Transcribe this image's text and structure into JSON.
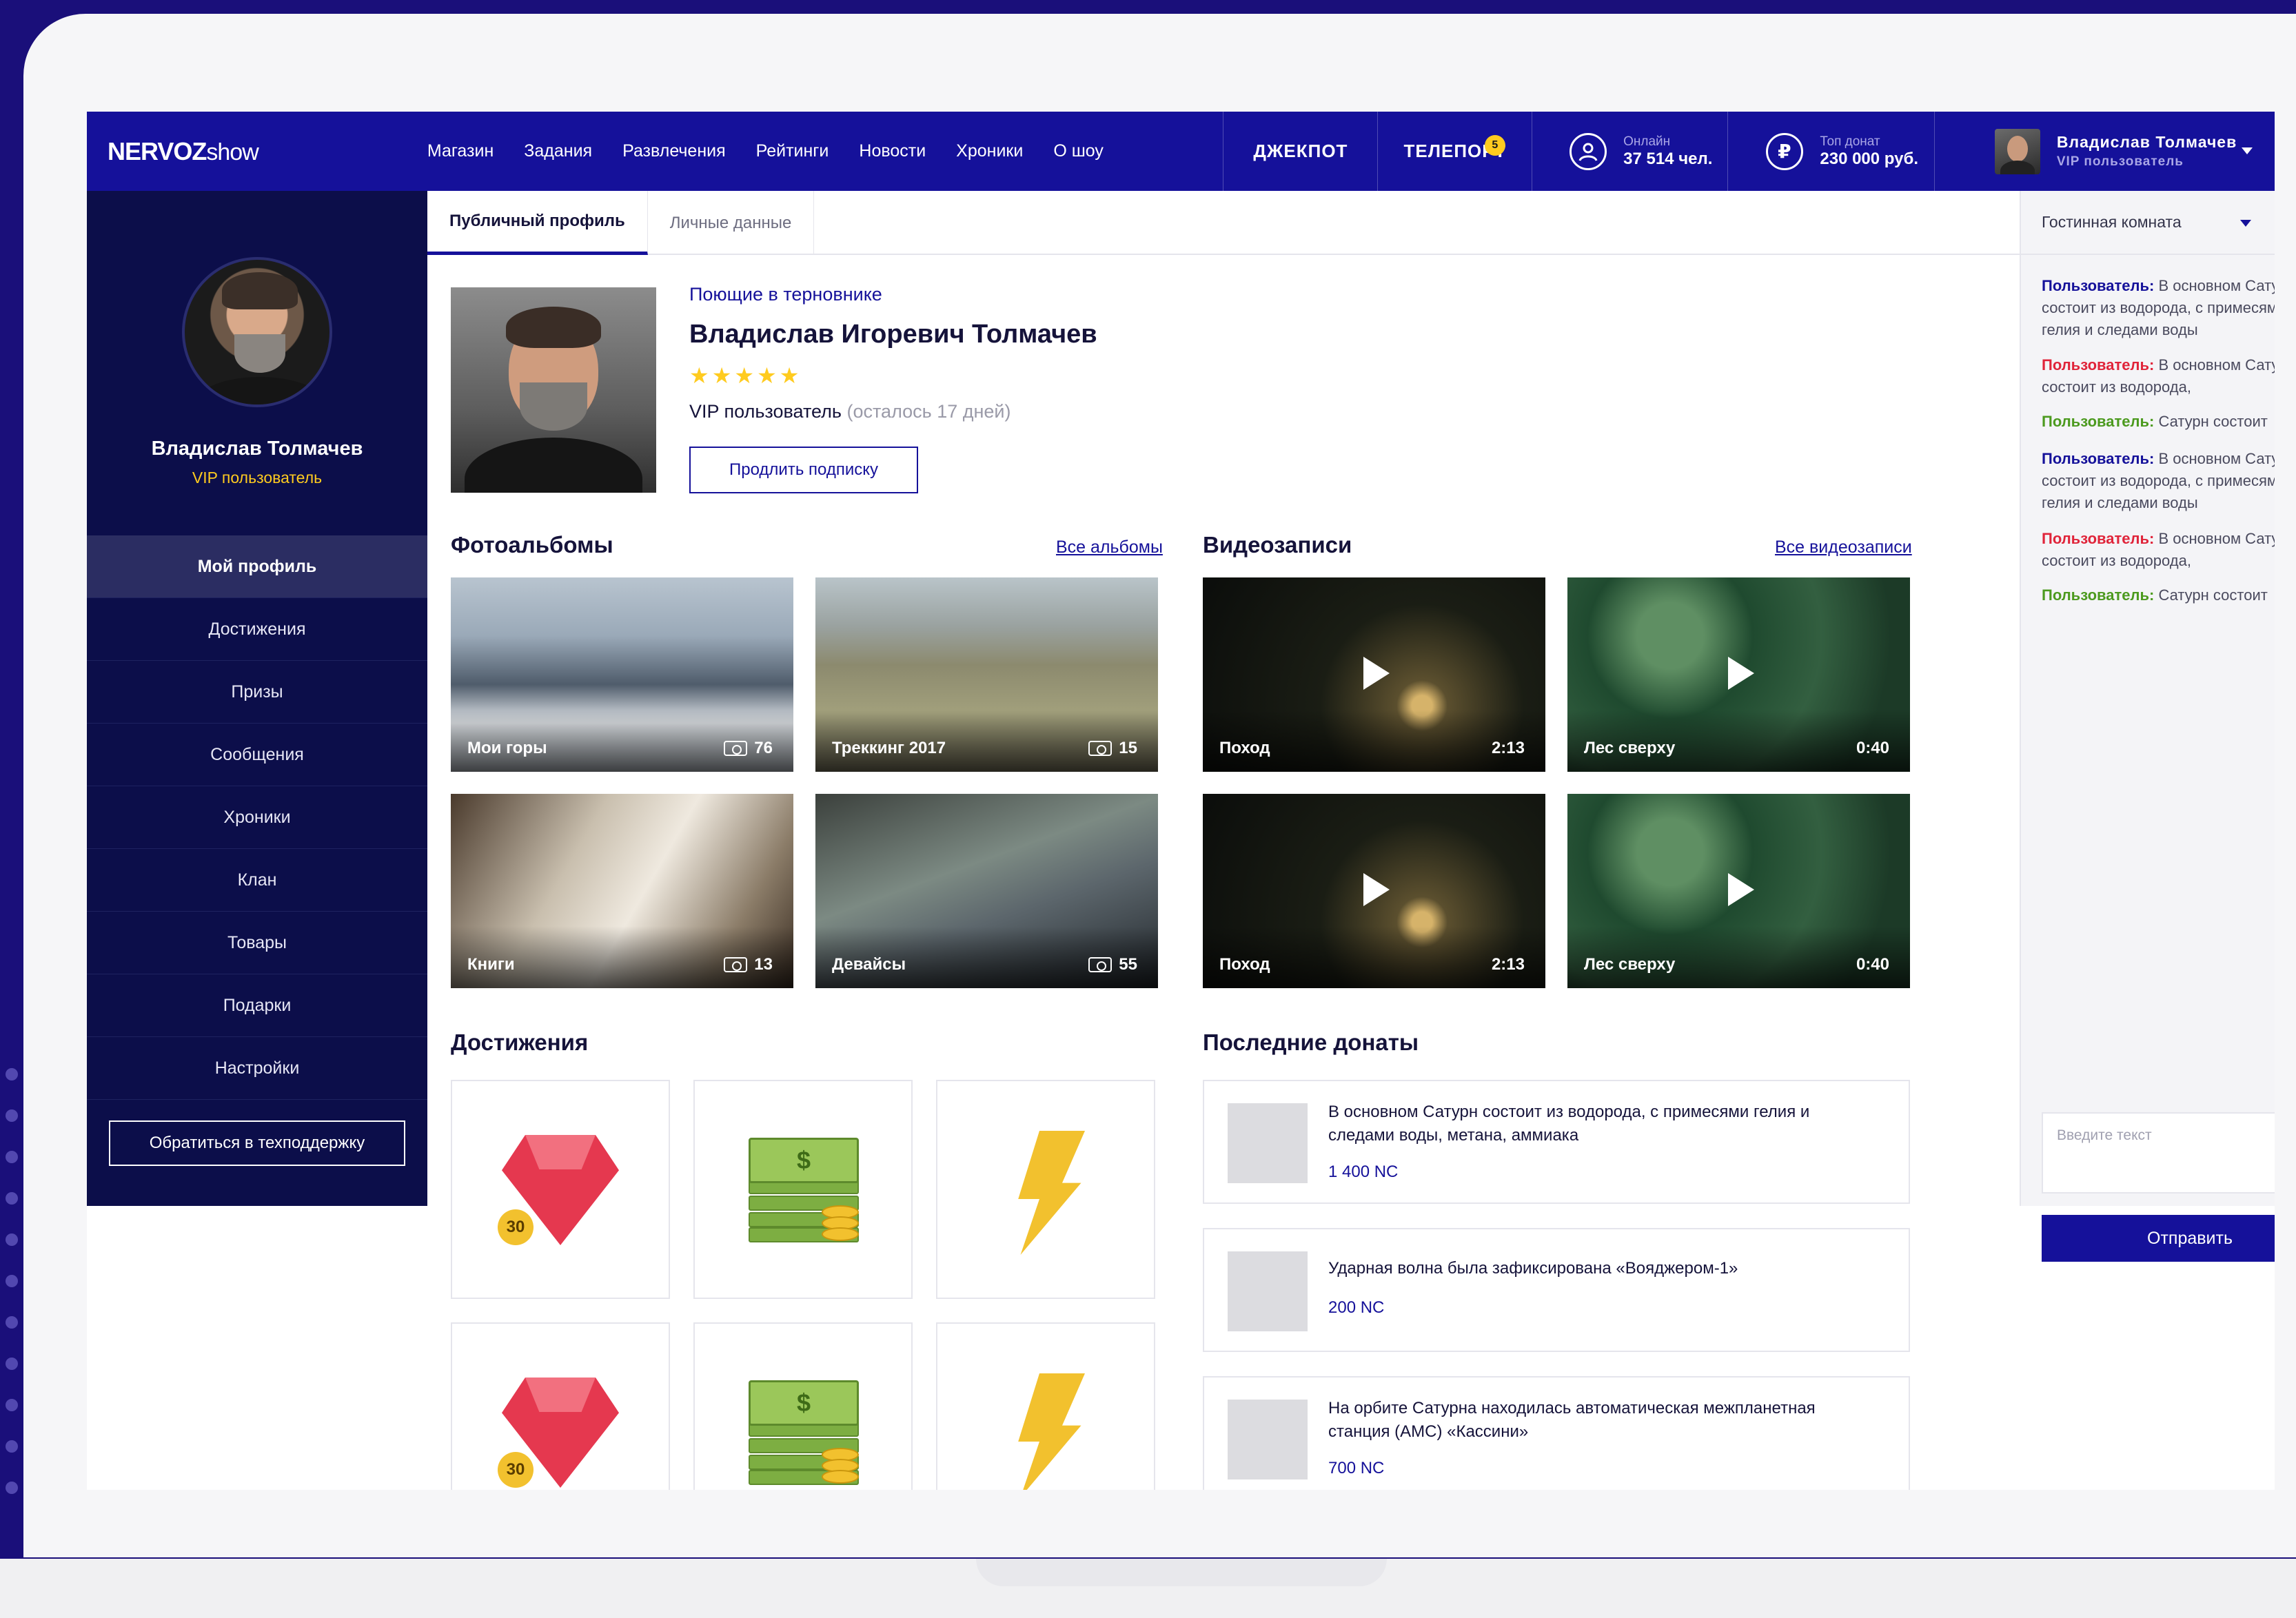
{
  "brand": {
    "logo_main": "NERVOZ",
    "logo_sub": "show"
  },
  "nav": {
    "items": [
      "Магазин",
      "Задания",
      "Развлечения",
      "Рейтинги",
      "Новости",
      "Хроники",
      "О шоу"
    ],
    "jackpot": "ДЖЕКПОТ",
    "teleport": "ТЕЛЕПОРТ",
    "teleport_badge": "5",
    "online_label": "Онлайн",
    "online_value": "37 514 чел.",
    "donat_label": "Топ донат",
    "donat_value": "230 000 руб.",
    "currency_symbol": "₽"
  },
  "user": {
    "name": "Владислав Толмачев",
    "role": "VIP пользователь"
  },
  "sidebar": {
    "name": "Владислав Толмачев",
    "role": "VIP пользователь",
    "items": [
      "Мой профиль",
      "Достижения",
      "Призы",
      "Сообщения",
      "Хроники",
      "Клан",
      "Товары",
      "Подарки",
      "Настройки"
    ],
    "active_index": 0,
    "support_label": "Обратиться в техподдержку"
  },
  "tabs": [
    "Публичный профиль",
    "Личные данные"
  ],
  "profile": {
    "tag": "Поющие в терновнике",
    "full_name": "Владислав Игоревич Толмачев",
    "stars": "★★★★★",
    "status": "VIP пользователь",
    "status_left": "(осталось 17 дней)",
    "renew_label": "Продлить подписку"
  },
  "albums": {
    "title": "Фотоальбомы",
    "all_link": "Все альбомы",
    "items": [
      {
        "label": "Мои горы",
        "count": "76"
      },
      {
        "label": "Треккинг 2017",
        "count": "15"
      },
      {
        "label": "Книги",
        "count": "13"
      },
      {
        "label": "Девайсы",
        "count": "55"
      }
    ]
  },
  "videos": {
    "title": "Видеозаписи",
    "all_link": "Все видеозаписи",
    "items": [
      {
        "label": "Поход",
        "duration": "2:13"
      },
      {
        "label": "Лес сверху",
        "duration": "0:40"
      },
      {
        "label": "Поход",
        "duration": "2:13"
      },
      {
        "label": "Лес сверху",
        "duration": "0:40"
      }
    ]
  },
  "achievements": {
    "title": "Достижения",
    "gem_value": "30",
    "money_symbol": "$"
  },
  "donations": {
    "title": "Последние донаты",
    "items": [
      {
        "text": "В основном Сатурн состоит из водорода, с примесями гелия и следами воды, метана, аммиака",
        "amount": "1 400 NC"
      },
      {
        "text": "Ударная волна была зафиксирована «Вояджером-1»",
        "amount": "200 NC"
      },
      {
        "text": "На орбите Сатурна находилась автоматическая межпланетная станция (АМС) «Кассини»",
        "amount": "700 NC"
      }
    ]
  },
  "chat": {
    "room": "Гостинная комната",
    "messages": [
      {
        "user": "Пользователь:",
        "text": "В основном Сатурн состоит из водорода, с примесями гелия и следами воды"
      },
      {
        "user": "Пользователь:",
        "text": "В основном Сатурн состоит из водорода,"
      },
      {
        "user": "Пользователь:",
        "text": "Сатурн состоит"
      },
      {
        "user": "Пользователь:",
        "text": "В основном Сатурн состоит из водорода, с примесями гелия и следами воды"
      },
      {
        "user": "Пользователь:",
        "text": "В основном Сатурн состоит из водорода,"
      },
      {
        "user": "Пользователь:",
        "text": "Сатурн состоит"
      }
    ],
    "input_placeholder": "Введите текст",
    "send_label": "Отправить"
  },
  "colors": {
    "brand_blue": "#15119a",
    "sidebar_dark": "#0c0e4a",
    "accent_yellow": "#ffcb1f",
    "user_blue": "#15119a",
    "user_red": "#e0243a",
    "user_green": "#4c9a1f"
  }
}
